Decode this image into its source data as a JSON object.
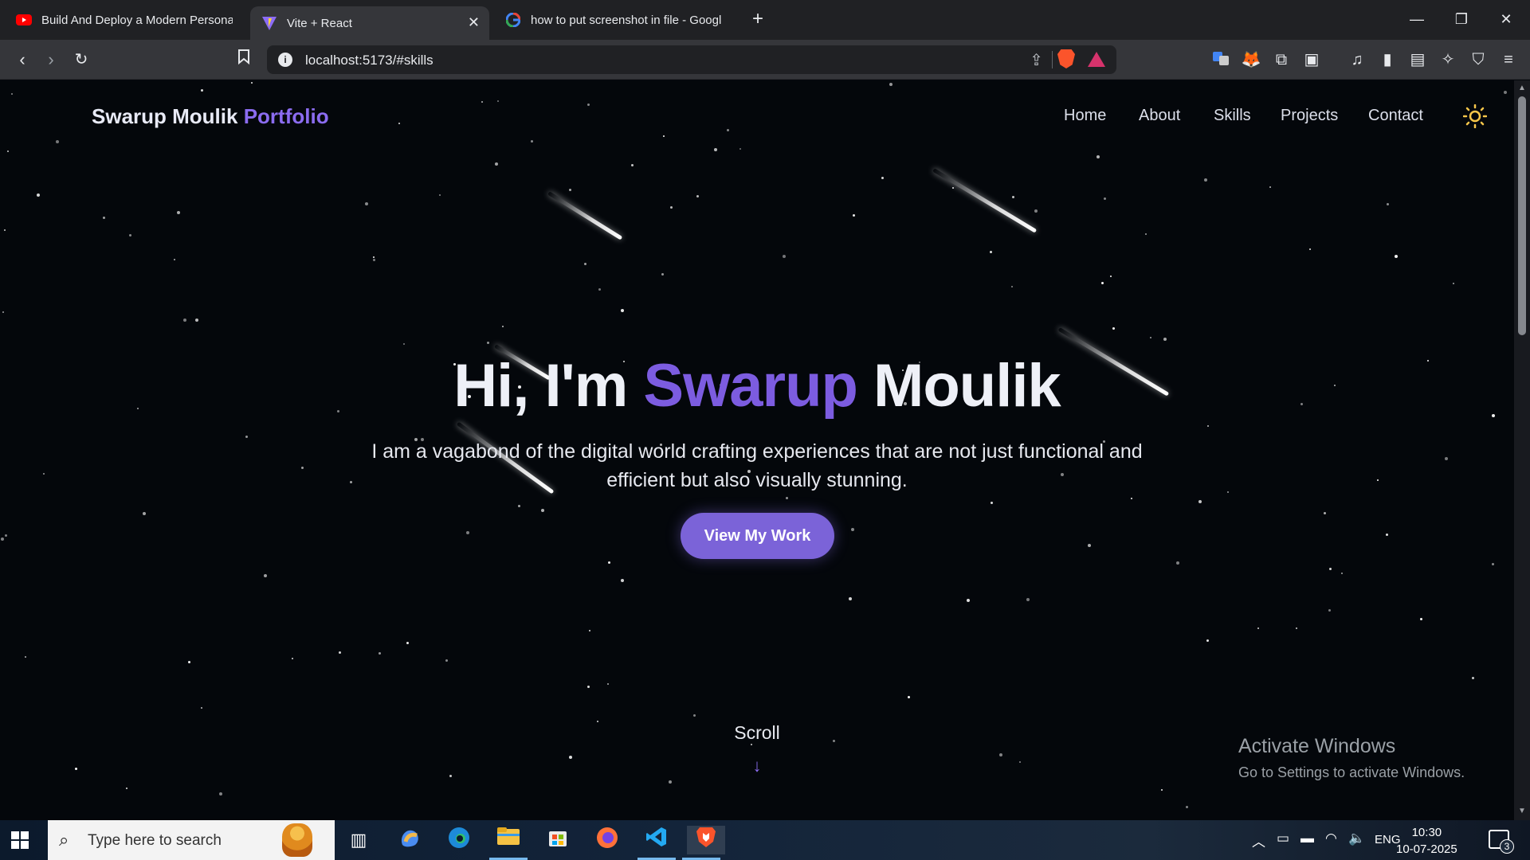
{
  "browser": {
    "tabs": [
      {
        "title": "Build And Deploy a Modern Personal",
        "icon": "youtube-icon",
        "active": false
      },
      {
        "title": "Vite + React",
        "icon": "vite-icon",
        "active": true
      },
      {
        "title": "how to put screenshot in file - Googl",
        "icon": "google-icon",
        "active": false
      }
    ],
    "new_tab": "+",
    "window_controls": {
      "minimize": "—",
      "restore": "❐",
      "close": "✕"
    },
    "url": "localhost:5173/#skills"
  },
  "page": {
    "logo": {
      "name": "Swarup Moulik",
      "accent": "Portfolio"
    },
    "nav": [
      "Home",
      "About",
      "Skills",
      "Projects",
      "Contact"
    ],
    "hero": {
      "greeting": "Hi, I'm",
      "first_name": "Swarup",
      "last_name": "Moulik",
      "subtitle_line1": "I am a vagabond of the digital world crafting experiences that are not just functional and",
      "subtitle_line2": "efficient but also visually stunning.",
      "cta": "View My Work"
    },
    "scroll_label": "Scroll",
    "scroll_arrow": "↓",
    "colors": {
      "accent": "#7c5ce0",
      "background": "#04070b",
      "button": "#7b63d8"
    }
  },
  "watermark": {
    "title": "Activate Windows",
    "subtitle": "Go to Settings to activate Windows."
  },
  "taskbar": {
    "search_placeholder": "Type here to search",
    "language": "ENG",
    "time": "10:30",
    "date": "10-07-2025",
    "notification_count": "3"
  }
}
